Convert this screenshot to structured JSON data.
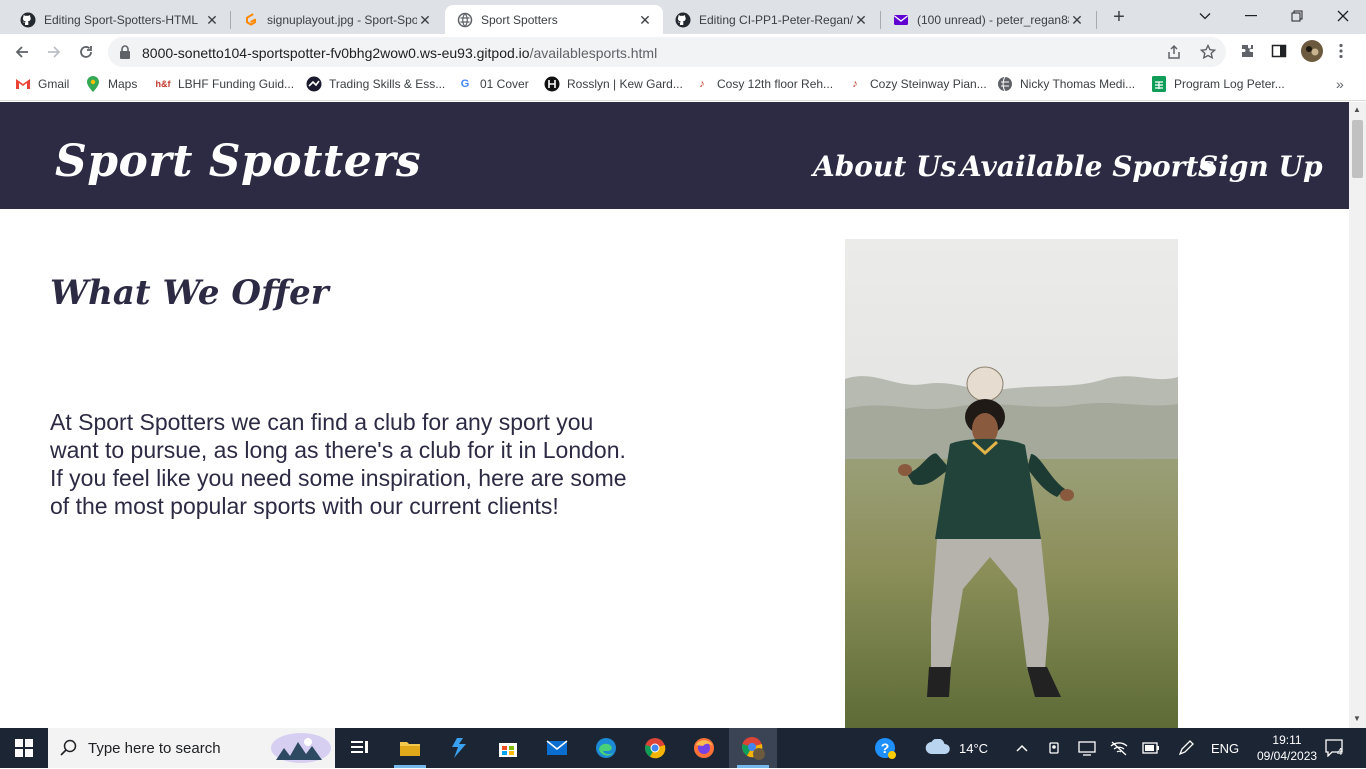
{
  "browser": {
    "tabs": [
      {
        "title": "Editing Sport-Spotters-HTML",
        "icon": "github-icon"
      },
      {
        "title": "signuplayout.jpg - Sport-Spo",
        "icon": "gitpod-icon"
      },
      {
        "title": "Sport Spotters",
        "icon": "globe-icon"
      },
      {
        "title": "Editing CI-PP1-Peter-Regan/",
        "icon": "github-icon"
      },
      {
        "title": "(100 unread) - peter_regan88",
        "icon": "mail-icon"
      }
    ],
    "active_tab": 2,
    "url_host": "8000-sonetto104-sportspotter-fv0bhg2wow0.ws-eu93.gitpod.io",
    "url_path": "/availablesports.html",
    "bookmarks": [
      {
        "label": "Gmail",
        "icon": "gmail-icon"
      },
      {
        "label": "Maps",
        "icon": "maps-icon"
      },
      {
        "label": "LBHF Funding Guid...",
        "icon": "lbhf-icon"
      },
      {
        "label": "Trading Skills & Ess...",
        "icon": "trading-icon"
      },
      {
        "label": "01 Cover",
        "icon": "google-icon"
      },
      {
        "label": "Rosslyn | Kew Gard...",
        "icon": "rosslyn-icon"
      },
      {
        "label": "Cosy 12th floor Reh...",
        "icon": "music-icon"
      },
      {
        "label": "Cozy Steinway Pian...",
        "icon": "music-icon"
      },
      {
        "label": "Nicky Thomas Medi...",
        "icon": "globe-icon"
      },
      {
        "label": "Program Log Peter...",
        "icon": "sheets-icon"
      }
    ]
  },
  "site": {
    "logo": "Sport Spotters",
    "nav": [
      "About Us",
      "Available Sports",
      "Sign Up"
    ],
    "section_title": "What We Offer",
    "intro": "At Sport Spotters we can find a club for any sport you want to pursue, as long as there's a club for it in London. If you feel like you need some inspiration, here are some of the most popular sports with our current clients!"
  },
  "taskbar": {
    "search_placeholder": "Type here to search",
    "weather": "14°C",
    "language": "ENG",
    "time": "19:11",
    "date": "09/04/2023",
    "notifications": "4"
  },
  "colors": {
    "header_bg": "#2d2b44",
    "header_text": "#ffffff",
    "body_text": "#2d2b44"
  }
}
